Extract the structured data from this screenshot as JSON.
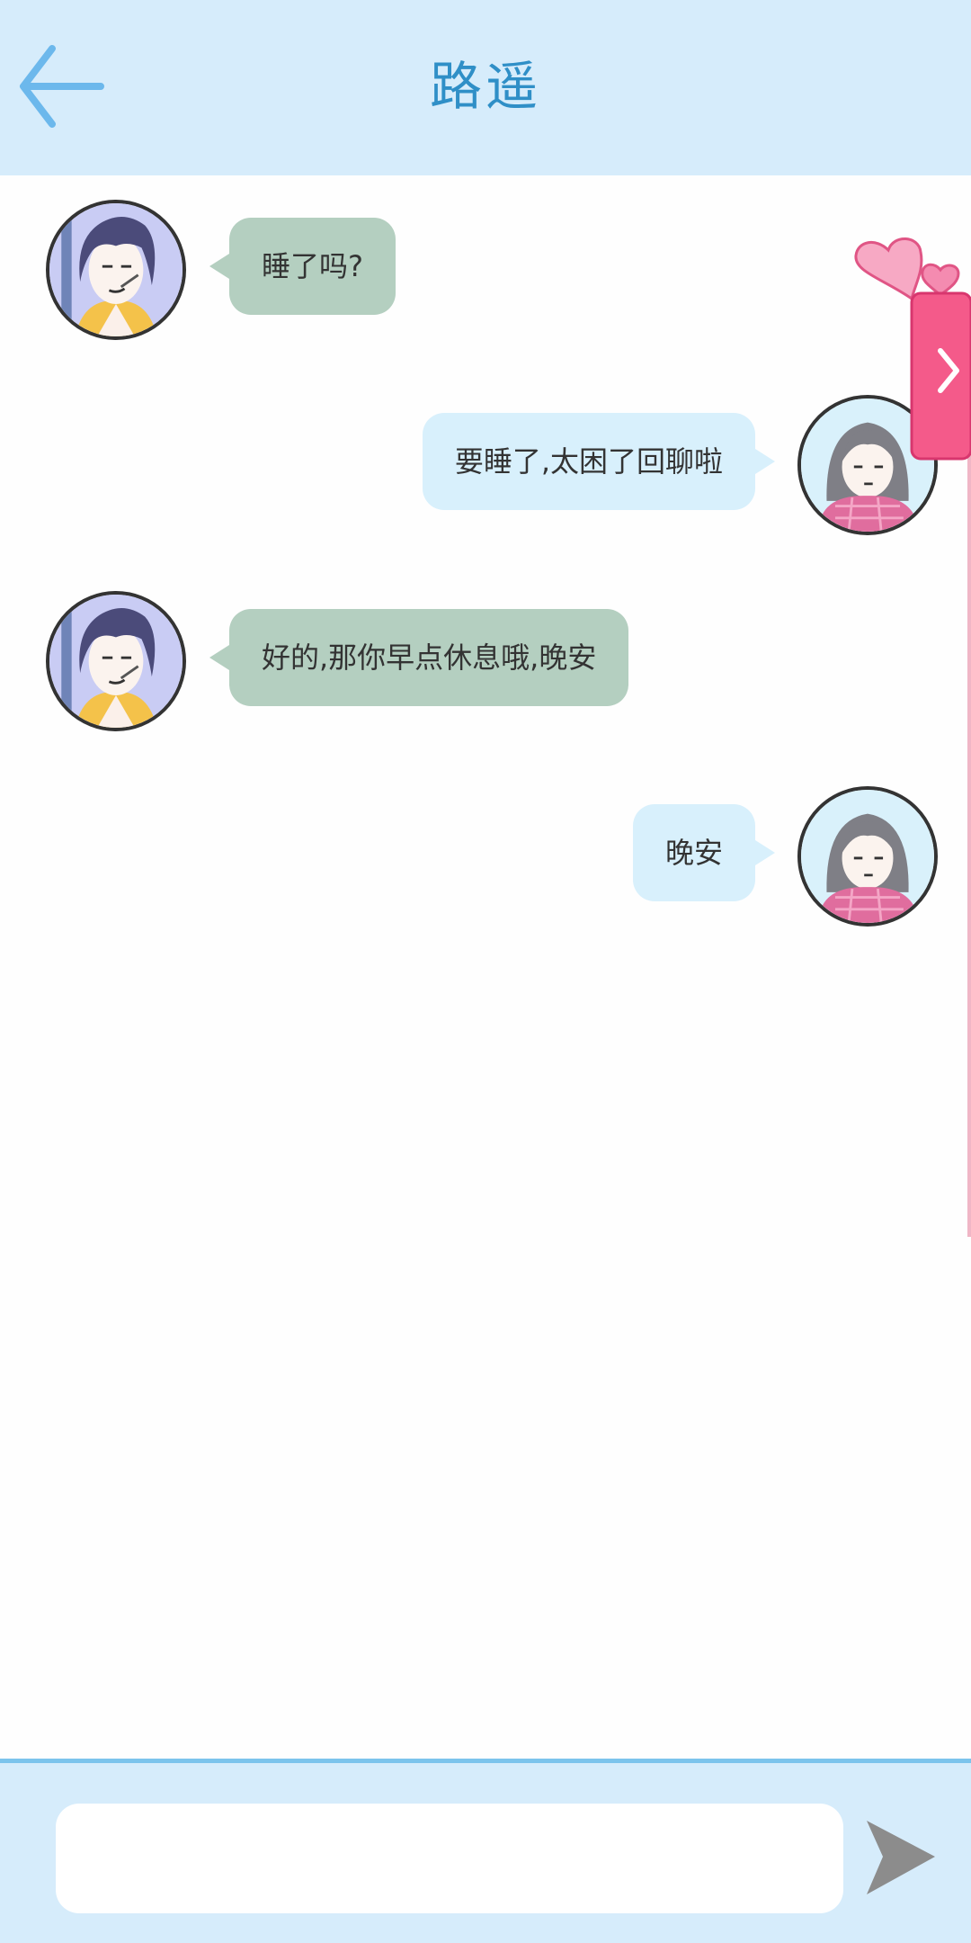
{
  "header": {
    "back_icon": "arrow-left-icon",
    "title": "路遥"
  },
  "messages": [
    {
      "side": "left",
      "text": "睡了吗?"
    },
    {
      "side": "right",
      "text": "要睡了,太困了回聊啦"
    },
    {
      "side": "left",
      "text": "好的,那你早点休息哦,晚安"
    },
    {
      "side": "right",
      "text": "晚安"
    }
  ],
  "side_tab": {
    "icon": "chevron-right-icon",
    "decoration": "heart-icon"
  },
  "composer": {
    "placeholder": "",
    "send_icon": "send-icon"
  },
  "colors": {
    "header_bg": "#d6ecfb",
    "title": "#2f8fc7",
    "back_arrow": "#6cb8ec",
    "left_bubble": "#b4cfc0",
    "right_bubble": "#d8f0fc",
    "send_icon": "#8c8c8c",
    "side_tab": "#f45a8a"
  }
}
